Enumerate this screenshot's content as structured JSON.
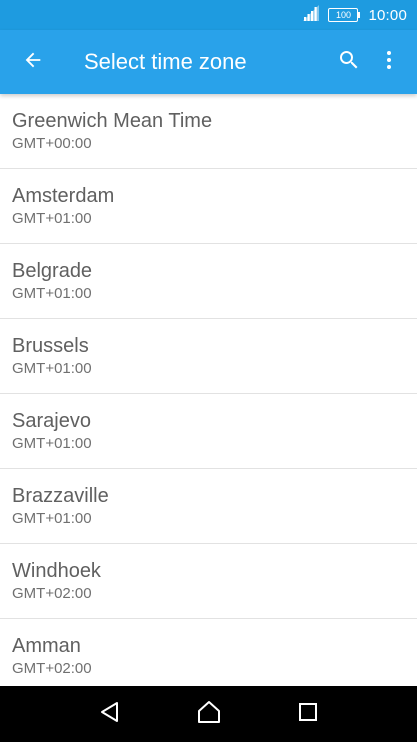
{
  "status_bar": {
    "battery": "100",
    "time": "10:00",
    "signal_icon": "signal-icon",
    "battery_icon": "battery-icon"
  },
  "app_bar": {
    "title": "Select time zone",
    "back_icon": "back-arrow-icon",
    "search_icon": "search-icon",
    "overflow_icon": "more-vert-icon",
    "color": "#29a2ea"
  },
  "time_zones": [
    {
      "name": "Greenwich Mean Time",
      "offset": "GMT+00:00"
    },
    {
      "name": "Amsterdam",
      "offset": "GMT+01:00"
    },
    {
      "name": "Belgrade",
      "offset": "GMT+01:00"
    },
    {
      "name": "Brussels",
      "offset": "GMT+01:00"
    },
    {
      "name": "Sarajevo",
      "offset": "GMT+01:00"
    },
    {
      "name": "Brazzaville",
      "offset": "GMT+01:00"
    },
    {
      "name": "Windhoek",
      "offset": "GMT+02:00"
    },
    {
      "name": "Amman",
      "offset": "GMT+02:00"
    }
  ],
  "nav_bar": {
    "back_icon": "nav-back-icon",
    "home_icon": "nav-home-icon",
    "recents_icon": "nav-recents-icon"
  }
}
